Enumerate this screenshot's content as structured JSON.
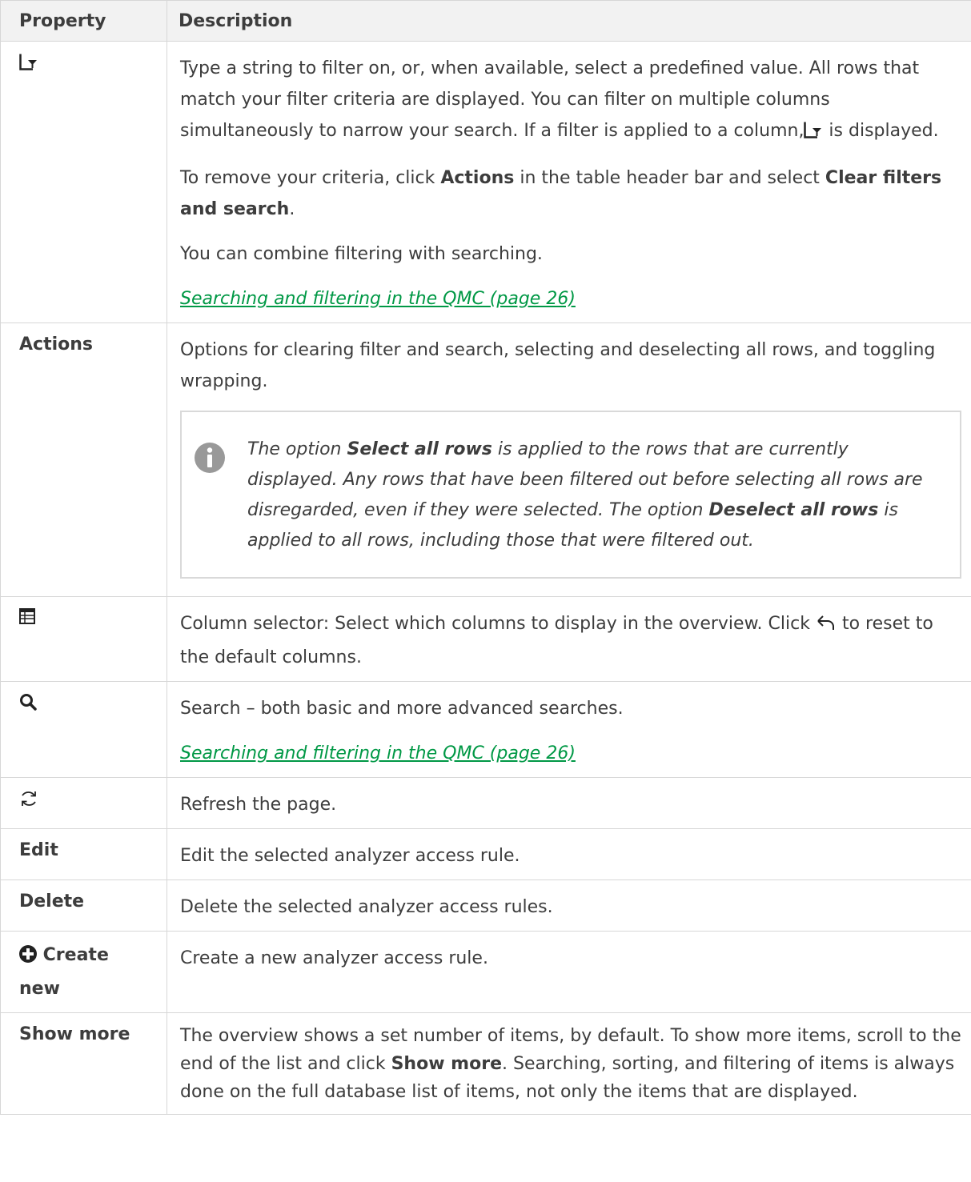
{
  "header": {
    "property": "Property",
    "description": "Description"
  },
  "rows": {
    "filter": {
      "icon": "filter-icon",
      "p1_a": "Type a string to filter on, or, when available, select a predefined value. All rows that match your filter criteria are displayed. You can filter on multiple columns simultaneously to narrow your search. If a filter is applied to a column,",
      "p1_b": " is displayed.",
      "p2_a": "To remove your criteria, click ",
      "p2_b1": "Actions",
      "p2_c": " in the table header bar and select ",
      "p2_b2": "Clear filters and search",
      "p2_d": ".",
      "p3": "You can combine filtering with searching.",
      "link": " Searching and filtering in the QMC (page 26)"
    },
    "actions": {
      "label": "Actions",
      "desc": "Options for clearing filter and search, selecting and deselecting all rows, and toggling wrapping.",
      "note_icon": "info-icon",
      "note_a": "The option ",
      "note_b1": "Select all rows",
      "note_c": " is applied to the rows that are currently displayed. Any rows that have been filtered out before selecting all rows are disregarded, even if they were selected. The option ",
      "note_b2": "Deselect all rows",
      "note_d": " is applied to all rows, including those that were filtered out."
    },
    "columns": {
      "icon": "table-icon",
      "desc_a": "Column selector: Select which columns to display in the overview. Click ",
      "desc_icon": "undo-icon",
      "desc_b": " to reset to the default columns."
    },
    "search": {
      "icon": "search-icon",
      "desc": "Search – both basic and more advanced searches.",
      "link": " Searching and filtering in the QMC (page 26)"
    },
    "refresh": {
      "icon": "refresh-icon",
      "desc": "Refresh the page."
    },
    "edit": {
      "label": "Edit",
      "desc": "Edit the selected analyzer access rule."
    },
    "delete": {
      "label": "Delete",
      "desc": "Delete the selected analyzer access rules."
    },
    "create": {
      "icon": "plus-circle-icon",
      "label": " Create new",
      "desc": "Create a new analyzer access rule."
    },
    "show_more": {
      "label": "Show more",
      "desc_a": "The overview shows a set number of items, by default. To show more items, scroll to the end of the list and click ",
      "desc_b": "Show more",
      "desc_c": ". Searching, sorting, and filtering of items is always done on the full database list of items, not only the items that are displayed."
    }
  },
  "colors": {
    "link": "#009845",
    "border": "#d7d7d7",
    "header_bg": "#f2f2f2",
    "info_icon": "#999999"
  }
}
